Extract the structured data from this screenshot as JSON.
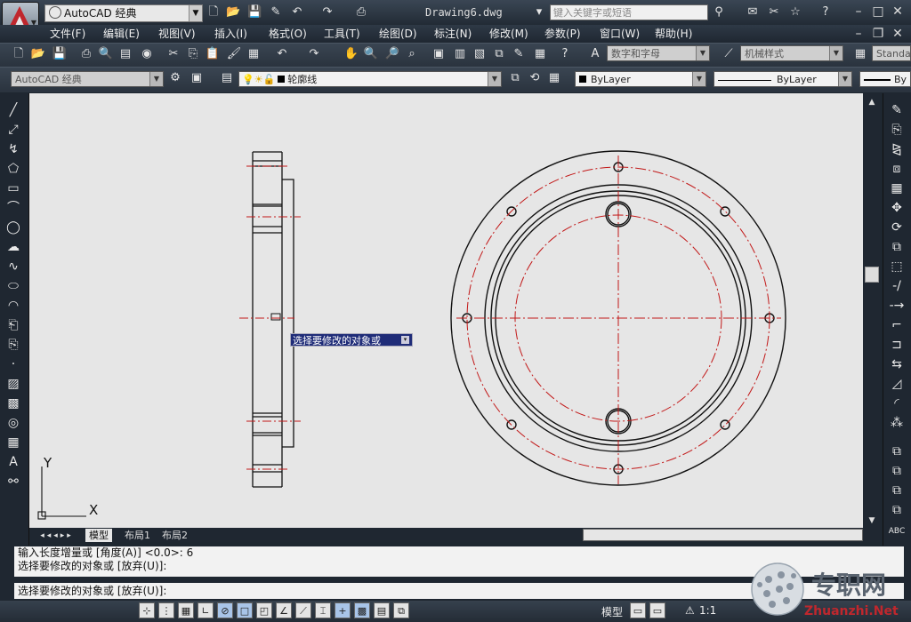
{
  "title_bar": {
    "workspace": "AutoCAD 经典",
    "document_title": "Drawing6.dwg",
    "search_placeholder": "键入关键字或短语"
  },
  "menu": [
    "文件(F)",
    "编辑(E)",
    "视图(V)",
    "插入(I)",
    "格式(O)",
    "工具(T)",
    "绘图(D)",
    "标注(N)",
    "修改(M)",
    "参数(P)",
    "窗口(W)",
    "帮助(H)"
  ],
  "toolbar1": {
    "text_style": "数字和字母",
    "dim_style": "机械样式",
    "table_style": "Standa"
  },
  "toolbar2": {
    "workspace": "AutoCAD 经典",
    "layer": "轮廓线",
    "color": "ByLayer",
    "linetype": "ByLayer",
    "lineweight": "By"
  },
  "canvas": {
    "tooltip": "选择要修改的对象或",
    "ucs_y": "Y",
    "ucs_x": "X"
  },
  "layout_tabs": [
    "模型",
    "布局1",
    "布局2"
  ],
  "command": {
    "history_line1": "输入长度增量或 [角度(A)] <0.0>: 6",
    "history_line2": "选择要修改的对象或 [放弃(U)]:",
    "current_line": "选择要修改的对象或 [放弃(U)]:"
  },
  "status": {
    "model_label": "模型",
    "scale": "1:1"
  },
  "watermark": {
    "text": "专职网",
    "url": "Zhuanzhi.Net"
  }
}
